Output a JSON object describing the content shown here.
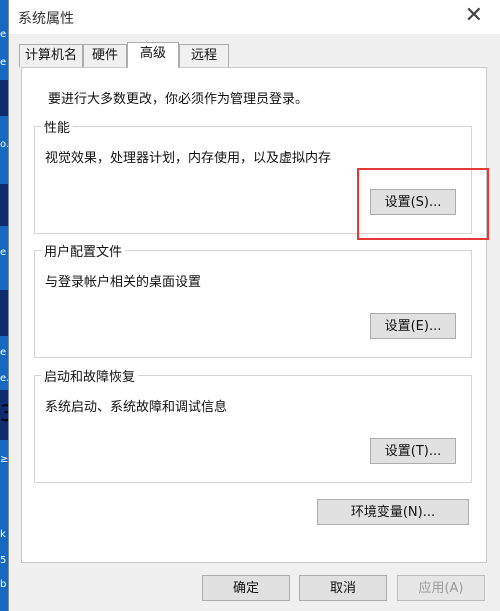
{
  "window": {
    "title": "系统属性",
    "close_glyph": "✕"
  },
  "tabs": [
    {
      "label": "计算机名",
      "active": false
    },
    {
      "label": "硬件",
      "active": false
    },
    {
      "label": "高级",
      "active": true
    },
    {
      "label": "远程",
      "active": false
    }
  ],
  "intro": "要进行大多数更改，你必须作为管理员登录。",
  "performance": {
    "title": "性能",
    "description": "视觉效果，处理器计划，内存使用，以及虚拟内存",
    "button": "设置(S)..."
  },
  "user_profiles": {
    "title": "用户配置文件",
    "description": "与登录帐户相关的桌面设置",
    "button": "设置(E)..."
  },
  "startup_recovery": {
    "title": "启动和故障恢复",
    "description": "系统启动、系统故障和调试信息",
    "button": "设置(T)..."
  },
  "env_button": "环境变量(N)...",
  "footer": {
    "ok": "确定",
    "cancel": "取消",
    "apply": "应用(A)"
  },
  "desktop_fragments": [
    "e",
    "e",
    "o.",
    "e",
    "e",
    "e.",
    "3",
    "≥",
    "k",
    "5",
    "b"
  ],
  "colors": {
    "highlight": "#e53935",
    "desktop": "#1a6fc4"
  }
}
